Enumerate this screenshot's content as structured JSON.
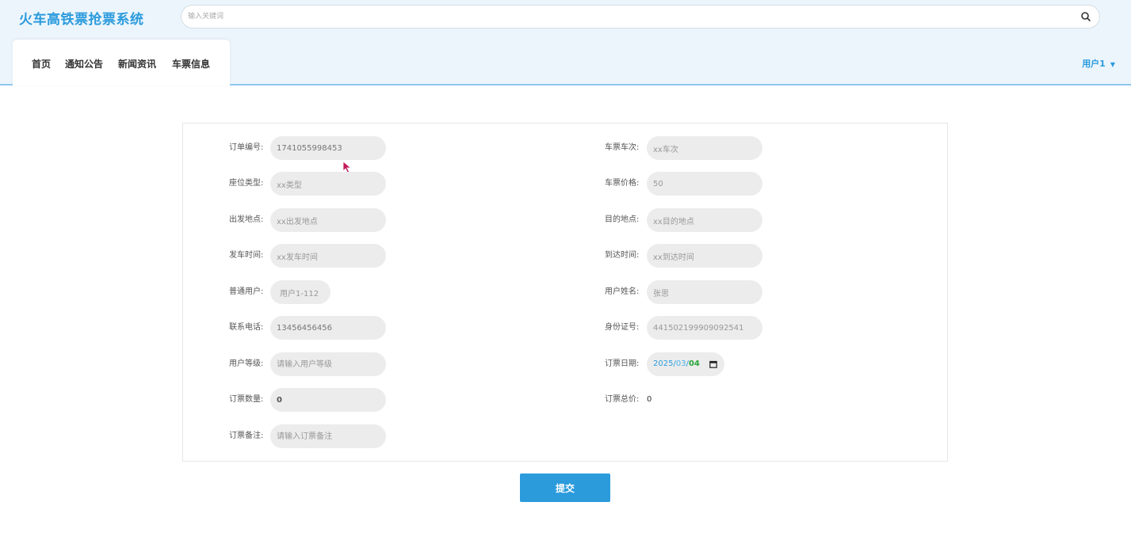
{
  "header": {
    "site_title": "火车高铁票抢票系统",
    "search_placeholder": "输入关键词",
    "nav": [
      "首页",
      "通知公告",
      "新闻资讯",
      "车票信息"
    ],
    "user_label": "用户1",
    "colors": {
      "accent": "#2b9bdc",
      "header_bg": "#ecf5fc"
    }
  },
  "form": {
    "left": [
      {
        "label": "订单编号:",
        "value": "1741055998453",
        "placeholder": ""
      },
      {
        "label": "座位类型:",
        "value": "xx类型",
        "placeholder": ""
      },
      {
        "label": "出发地点:",
        "value": "xx出发地点",
        "placeholder": ""
      },
      {
        "label": "发车时间:",
        "value": "xx发车时间",
        "placeholder": ""
      },
      {
        "label": "普通用户:",
        "value": "用户1-112",
        "placeholder": ""
      },
      {
        "label": "联系电话:",
        "value": "13456456456",
        "placeholder": ""
      },
      {
        "label": "用户等级:",
        "value": "",
        "placeholder": "请输入用户等级"
      },
      {
        "label": "订票数量:",
        "value": "0",
        "placeholder": ""
      },
      {
        "label": "订票备注:",
        "value": "",
        "placeholder": "请输入订票备注"
      }
    ],
    "right": [
      {
        "label": "车票车次:",
        "value": "xx车次",
        "placeholder": ""
      },
      {
        "label": "车票价格:",
        "value": "50",
        "placeholder": ""
      },
      {
        "label": "目的地点:",
        "value": "xx目的地点",
        "placeholder": ""
      },
      {
        "label": "到达时间:",
        "value": "xx到达时间",
        "placeholder": ""
      },
      {
        "label": "用户姓名:",
        "value": "张思",
        "placeholder": ""
      },
      {
        "label": "身份证号:",
        "value": "441502199909092541",
        "placeholder": ""
      }
    ],
    "booking_date": {
      "label": "订票日期:",
      "year": "2025",
      "month": "03",
      "day": "04"
    },
    "total": {
      "label": "订票总价:",
      "value": "0"
    },
    "submit_label": "提交"
  }
}
